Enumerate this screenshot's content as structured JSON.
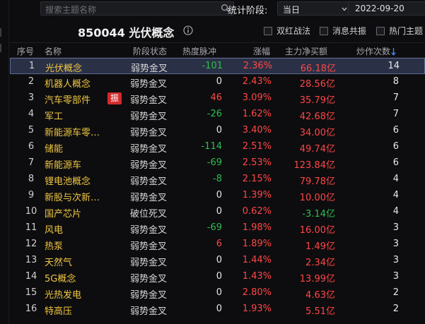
{
  "search": {
    "placeholder": "搜索主题名称"
  },
  "stat": {
    "label": "统计阶段:",
    "period": "当日",
    "date": "2022-09-20"
  },
  "header": {
    "title": "850044 光伏概念"
  },
  "filters": [
    {
      "label": "双红战法",
      "checked": false
    },
    {
      "label": "消息共振",
      "checked": false
    },
    {
      "label": "热门主题",
      "checked": false
    }
  ],
  "columns": {
    "no": "序号",
    "name": "名称",
    "state": "阶段状态",
    "heat": "热度脉冲",
    "pct": "涨幅",
    "flow": "主力净买额",
    "count": "炒作次数"
  },
  "colors": {
    "up": "#ff4646",
    "down": "#2fbf4f",
    "name": "#f0c642",
    "badge": "#d32b2b",
    "selected": "#2a3146"
  },
  "rows": [
    {
      "no": "1",
      "name": "光伏概念",
      "badge": "",
      "state": "弱势金叉",
      "heat": "-101",
      "pct": "2.36%",
      "flow": "66.18亿",
      "count": "14",
      "selected": true
    },
    {
      "no": "2",
      "name": "机器人概念",
      "badge": "",
      "state": "弱势金叉",
      "heat": "0",
      "pct": "2.43%",
      "flow": "28.56亿",
      "count": "8"
    },
    {
      "no": "3",
      "name": "汽车零部件",
      "badge": "振",
      "state": "弱势金叉",
      "heat": "46",
      "pct": "3.09%",
      "flow": "35.79亿",
      "count": "7"
    },
    {
      "no": "4",
      "name": "军工",
      "badge": "",
      "state": "弱势金叉",
      "heat": "-26",
      "pct": "1.62%",
      "flow": "42.68亿",
      "count": "7"
    },
    {
      "no": "5",
      "name": "新能源车零…",
      "badge": "",
      "state": "弱势金叉",
      "heat": "0",
      "pct": "3.40%",
      "flow": "34.00亿",
      "count": "6"
    },
    {
      "no": "6",
      "name": "储能",
      "badge": "",
      "state": "弱势金叉",
      "heat": "-114",
      "pct": "2.51%",
      "flow": "49.74亿",
      "count": "6"
    },
    {
      "no": "7",
      "name": "新能源车",
      "badge": "",
      "state": "弱势金叉",
      "heat": "-69",
      "pct": "2.53%",
      "flow": "123.84亿",
      "count": "6"
    },
    {
      "no": "8",
      "name": "锂电池概念",
      "badge": "",
      "state": "弱势金叉",
      "heat": "-8",
      "pct": "2.15%",
      "flow": "79.78亿",
      "count": "4"
    },
    {
      "no": "9",
      "name": "新股与次新…",
      "badge": "",
      "state": "弱势金叉",
      "heat": "0",
      "pct": "1.39%",
      "flow": "10.00亿",
      "count": "4"
    },
    {
      "no": "10",
      "name": "国产芯片",
      "badge": "",
      "state": "破位死叉",
      "heat": "0",
      "pct": "0.62%",
      "flow": "-3.14亿",
      "count": "4"
    },
    {
      "no": "11",
      "name": "风电",
      "badge": "",
      "state": "弱势金叉",
      "heat": "-69",
      "pct": "1.98%",
      "flow": "16.00亿",
      "count": "3"
    },
    {
      "no": "12",
      "name": "热泵",
      "badge": "",
      "state": "弱势金叉",
      "heat": "6",
      "pct": "1.89%",
      "flow": "1.49亿",
      "count": "3"
    },
    {
      "no": "13",
      "name": "天然气",
      "badge": "",
      "state": "弱势金叉",
      "heat": "0",
      "pct": "1.44%",
      "flow": "2.34亿",
      "count": "3"
    },
    {
      "no": "14",
      "name": "5G概念",
      "badge": "",
      "state": "弱势金叉",
      "heat": "0",
      "pct": "1.43%",
      "flow": "13.99亿",
      "count": "3"
    },
    {
      "no": "15",
      "name": "光热发电",
      "badge": "",
      "state": "弱势金叉",
      "heat": "0",
      "pct": "2.80%",
      "flow": "4.63亿",
      "count": "2"
    },
    {
      "no": "16",
      "name": "特高压",
      "badge": "",
      "state": "弱势金叉",
      "heat": "0",
      "pct": "1.93%",
      "flow": "5.51亿",
      "count": "2"
    }
  ]
}
